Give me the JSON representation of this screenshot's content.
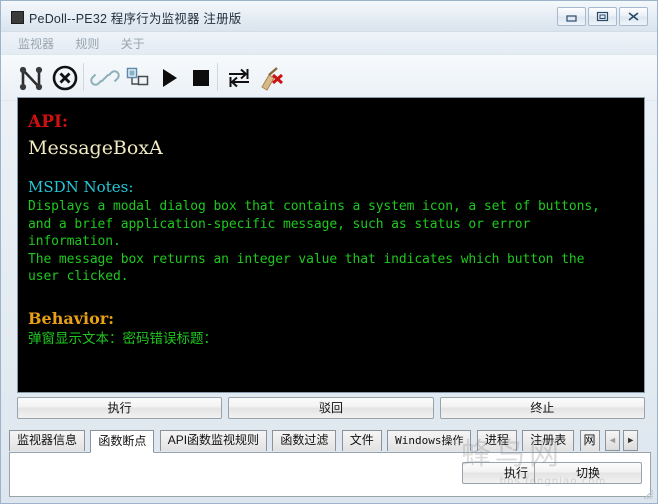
{
  "window": {
    "title": "PeDoll--PE32 程序行为监视器 注册版",
    "icon": "app-icon",
    "controls": {
      "minimize": "minimize-icon",
      "maximize": "maximize-icon",
      "close": "close-icon"
    }
  },
  "menu": {
    "items": [
      {
        "label": "监视器",
        "name": "menu-monitor"
      },
      {
        "label": "规则",
        "name": "menu-rules"
      },
      {
        "label": "关于",
        "name": "menu-about"
      }
    ]
  },
  "toolbar": {
    "items": [
      {
        "name": "connect-icon",
        "glyph": "N-nodes"
      },
      {
        "name": "disconnect-icon",
        "glyph": "circle-x"
      },
      {
        "name": "link-icon",
        "glyph": "chain-link"
      },
      {
        "name": "attach-process-icon",
        "glyph": "window-tree"
      },
      {
        "name": "start-icon",
        "glyph": "play-triangle"
      },
      {
        "name": "stop-icon",
        "glyph": "stop-square"
      },
      {
        "name": "exchange-icon",
        "glyph": "two-arrows"
      },
      {
        "name": "clear-icon",
        "glyph": "broom-x"
      }
    ]
  },
  "console": {
    "api_label": "API:",
    "api_name": "MessageBoxA",
    "msdn_label": "MSDN Notes:",
    "msdn_text": "Displays a modal dialog box that contains a system icon, a set of buttons,\nand a brief application-specific message, such as status or error\ninformation.\nThe message box returns an integer value that indicates which button the\nuser clicked.",
    "behavior_label": "Behavior:",
    "behavior_text": "弹窗显示文本：密码错误标题："
  },
  "actions": {
    "buttons": [
      {
        "label": "执行",
        "name": "execute-button"
      },
      {
        "label": "驳回",
        "name": "reject-button"
      },
      {
        "label": "终止",
        "name": "terminate-button"
      }
    ]
  },
  "tabs": {
    "items": [
      {
        "label": "监视器信息",
        "name": "tab-monitor-info",
        "active": false,
        "mono": false
      },
      {
        "label": "函数断点",
        "name": "tab-function-breakpoint",
        "active": true,
        "mono": false
      },
      {
        "label": "API函数监视规则",
        "name": "tab-api-monitor-rules",
        "active": false,
        "mono": false
      },
      {
        "label": "函数过滤",
        "name": "tab-function-filter",
        "active": false,
        "mono": false
      },
      {
        "label": "文件",
        "name": "tab-file",
        "active": false,
        "mono": false
      },
      {
        "label": "Windows操作",
        "name": "tab-windows-ops",
        "active": false,
        "mono": true
      },
      {
        "label": "进程",
        "name": "tab-process",
        "active": false,
        "mono": false
      },
      {
        "label": "注册表",
        "name": "tab-registry",
        "active": false,
        "mono": false
      },
      {
        "label": "网",
        "name": "tab-network",
        "active": false,
        "mono": false
      }
    ],
    "scroll_left": "◄",
    "scroll_right": "►"
  },
  "bottom": {
    "execute_label": "执行",
    "switch_label": "切换"
  },
  "watermark": {
    "text": "bbs.fengniao.com",
    "cn": "蜂鸟网"
  },
  "colors": {
    "console_bg": "#000000",
    "api_red": "#d01010",
    "api_name_cream": "#f0eac0",
    "msdn_cyan": "#25c8d8",
    "body_green": "#1ec81e",
    "behavior_orange": "#e8a016",
    "frame_blue": "#9cb3c9"
  }
}
